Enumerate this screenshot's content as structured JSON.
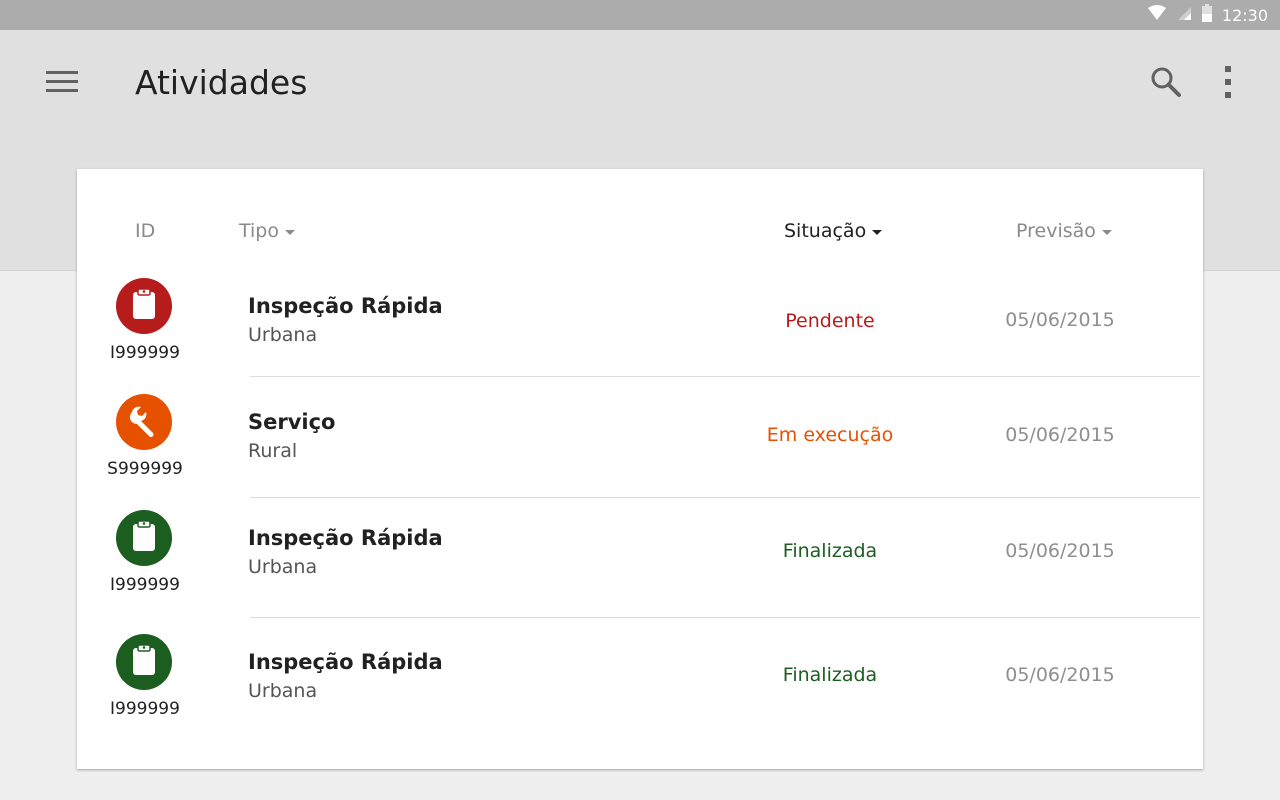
{
  "status_bar": {
    "time": "12:30",
    "icons": [
      "wifi-icon",
      "cell-signal-icon",
      "battery-icon"
    ]
  },
  "app_bar": {
    "title": "Atividades",
    "menu_icon": "menu-icon",
    "search_icon": "search-icon",
    "overflow_icon": "more-vert-icon"
  },
  "table": {
    "headers": {
      "id": "ID",
      "tipo": "Tipo",
      "situacao": "Situação",
      "previsao": "Previsão"
    },
    "sorted_by": "situacao",
    "rows": [
      {
        "id": "I999999",
        "icon": "clipboard-icon",
        "icon_color": "#b71c1c",
        "title": "Inspeção Rápida",
        "subtitle": "Urbana",
        "situacao": "Pendente",
        "situacao_color": "#b71c1c",
        "previsao": "05/06/2015"
      },
      {
        "id": "S999999",
        "icon": "wrench-icon",
        "icon_color": "#e65100",
        "title": "Serviço",
        "subtitle": "Rural",
        "situacao": "Em execução",
        "situacao_color": "#e65100",
        "previsao": "05/06/2015"
      },
      {
        "id": "I999999",
        "icon": "clipboard-icon",
        "icon_color": "#1b5e20",
        "title": "Inspeção Rápida",
        "subtitle": "Urbana",
        "situacao": "Finalizada",
        "situacao_color": "#1b5e20",
        "previsao": "05/06/2015"
      },
      {
        "id": "I999999",
        "icon": "clipboard-icon",
        "icon_color": "#1b5e20",
        "title": "Inspeção Rápida",
        "subtitle": "Urbana",
        "situacao": "Finalizada",
        "situacao_color": "#1b5e20",
        "previsao": "05/06/2015"
      }
    ]
  },
  "colors": {
    "status_bar": "#acacac",
    "app_bar": "#e0e0e0",
    "background": "#eeeeee",
    "card": "#ffffff"
  }
}
